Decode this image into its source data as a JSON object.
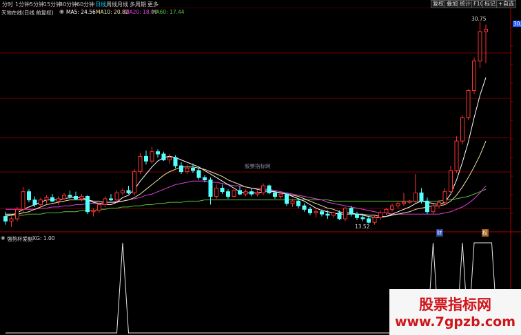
{
  "toolbar": {
    "periods": [
      "分时",
      "1分钟",
      "5分钟",
      "15分钟",
      "30分钟",
      "60分钟",
      "日线",
      "周线",
      "月线",
      "多周期",
      "更多"
    ],
    "active_period": "日线",
    "right_buttons": [
      "复权",
      "叠加",
      "统计",
      "F10",
      "标记",
      "+自选"
    ]
  },
  "main_panel": {
    "title": "天地在线(日线 前复权)",
    "ma": [
      {
        "label": "MA5: 24.56",
        "color": "#ffffff"
      },
      {
        "label": "MA10: 20.82",
        "color": "#f2e3a8"
      },
      {
        "label": "MA20: 18.09",
        "color": "#e040e0"
      },
      {
        "label": "MA60: 17.44",
        "color": "#58c038"
      }
    ],
    "high_label": "30.75",
    "low_label": "13.52",
    "price_tag": "30.",
    "watermark_center": "股票指标网",
    "event_markers": [
      "财",
      "权"
    ]
  },
  "indicator_panel": {
    "title": "强势杯爱副",
    "value_label": "XG: 1.00"
  },
  "watermark": {
    "title": "股票指标网",
    "url": "www.7gpzb.com"
  },
  "colors": {
    "up": "#ff3232",
    "down": "#54ffff",
    "grid": "#7a0000",
    "active": "#00d0ff"
  },
  "chart_data": {
    "type": "candlestick",
    "candles": [
      [
        14.2,
        14.6,
        13.5,
        13.8
      ],
      [
        13.8,
        14.2,
        13.3,
        14.0
      ],
      [
        14.0,
        15.0,
        13.8,
        14.8
      ],
      [
        14.8,
        16.7,
        14.5,
        16.3
      ],
      [
        16.3,
        16.5,
        15.4,
        15.6
      ],
      [
        15.6,
        15.9,
        15.0,
        15.2
      ],
      [
        15.2,
        15.8,
        15.0,
        15.6
      ],
      [
        15.6,
        16.0,
        15.3,
        15.8
      ],
      [
        15.8,
        16.1,
        15.4,
        15.5
      ],
      [
        15.5,
        15.9,
        15.2,
        15.7
      ],
      [
        15.7,
        16.2,
        15.6,
        16.0
      ],
      [
        16.0,
        16.4,
        15.7,
        15.9
      ],
      [
        15.9,
        16.3,
        15.6,
        15.7
      ],
      [
        15.7,
        16.1,
        15.5,
        15.9
      ],
      [
        15.9,
        16.0,
        14.4,
        14.6
      ],
      [
        14.6,
        14.9,
        14.2,
        14.7
      ],
      [
        14.7,
        15.4,
        14.5,
        15.2
      ],
      [
        15.2,
        15.9,
        15.0,
        15.7
      ],
      [
        15.7,
        16.1,
        15.5,
        15.6
      ],
      [
        15.6,
        16.4,
        15.4,
        16.2
      ],
      [
        16.2,
        16.6,
        16.0,
        16.4
      ],
      [
        16.4,
        16.8,
        16.1,
        16.2
      ],
      [
        16.2,
        18.2,
        16.0,
        18.0
      ],
      [
        18.0,
        19.6,
        17.8,
        19.3
      ],
      [
        19.3,
        19.8,
        18.6,
        18.9
      ],
      [
        18.9,
        20.1,
        18.7,
        19.7
      ],
      [
        19.7,
        19.9,
        19.2,
        19.5
      ],
      [
        19.5,
        19.7,
        18.9,
        19.0
      ],
      [
        19.0,
        19.5,
        18.7,
        19.2
      ],
      [
        19.2,
        19.4,
        18.3,
        18.5
      ],
      [
        18.5,
        18.8,
        17.8,
        18.0
      ],
      [
        18.0,
        18.6,
        17.8,
        18.3
      ],
      [
        18.3,
        18.7,
        17.9,
        18.1
      ],
      [
        18.1,
        18.4,
        17.3,
        17.5
      ],
      [
        17.5,
        17.7,
        17.1,
        17.3
      ],
      [
        17.3,
        17.5,
        15.2,
        15.9
      ],
      [
        15.9,
        16.9,
        15.7,
        16.6
      ],
      [
        16.6,
        16.9,
        16.1,
        16.3
      ],
      [
        16.3,
        16.5,
        15.7,
        15.9
      ],
      [
        15.9,
        16.6,
        15.8,
        16.4
      ],
      [
        16.4,
        16.8,
        16.0,
        16.1
      ],
      [
        16.1,
        16.5,
        15.9,
        16.3
      ],
      [
        16.3,
        16.6,
        15.9,
        16.1
      ],
      [
        16.1,
        16.4,
        15.9,
        16.2
      ],
      [
        16.2,
        17.0,
        16.0,
        16.8
      ],
      [
        16.8,
        16.9,
        16.1,
        16.2
      ],
      [
        16.2,
        16.4,
        15.7,
        15.9
      ],
      [
        15.9,
        16.2,
        15.7,
        16.1
      ],
      [
        16.1,
        16.2,
        15.1,
        15.3
      ],
      [
        15.3,
        15.7,
        15.0,
        15.5
      ],
      [
        15.5,
        15.7,
        14.9,
        15.1
      ],
      [
        15.1,
        15.3,
        14.6,
        14.8
      ],
      [
        14.8,
        15.0,
        14.3,
        14.5
      ],
      [
        14.5,
        14.9,
        14.1,
        14.6
      ],
      [
        14.6,
        14.8,
        14.2,
        14.4
      ],
      [
        14.4,
        14.7,
        14.0,
        14.3
      ],
      [
        14.3,
        14.6,
        14.1,
        14.5
      ],
      [
        14.5,
        14.7,
        13.9,
        14.0
      ],
      [
        14.0,
        15.0,
        13.8,
        14.9
      ],
      [
        14.9,
        15.1,
        14.2,
        14.4
      ],
      [
        14.4,
        14.6,
        13.9,
        14.1
      ],
      [
        14.1,
        14.4,
        13.8,
        14.0
      ],
      [
        14.0,
        14.2,
        13.6,
        13.7
      ],
      [
        13.7,
        14.3,
        13.5,
        14.1
      ],
      [
        14.1,
        14.7,
        13.9,
        14.5
      ],
      [
        14.5,
        14.9,
        14.3,
        14.8
      ],
      [
        14.8,
        15.3,
        14.6,
        15.1
      ],
      [
        15.1,
        15.5,
        14.9,
        15.3
      ],
      [
        15.3,
        16.2,
        15.1,
        15.4
      ],
      [
        15.4,
        15.6,
        15.3,
        15.5
      ],
      [
        15.5,
        17.8,
        15.3,
        16.2
      ],
      [
        16.2,
        16.6,
        15.3,
        15.5
      ],
      [
        15.5,
        15.8,
        14.4,
        14.6
      ],
      [
        14.6,
        15.3,
        14.4,
        15.1
      ],
      [
        15.1,
        15.6,
        14.9,
        15.4
      ],
      [
        15.4,
        16.6,
        15.2,
        16.3
      ],
      [
        16.3,
        18.5,
        16.1,
        18.1
      ],
      [
        18.1,
        21.0,
        17.9,
        20.6
      ],
      [
        20.6,
        22.8,
        20.3,
        22.6
      ],
      [
        22.6,
        25.0,
        22.4,
        24.9
      ],
      [
        24.9,
        27.7,
        24.6,
        27.4
      ],
      [
        27.4,
        30.75,
        26.8,
        29.9
      ],
      [
        29.9,
        30.5,
        27.2,
        30.1
      ]
    ],
    "ma5": [
      14.3,
      14.3,
      14.5,
      14.8,
      15.0,
      15.2,
      15.4,
      15.6,
      15.6,
      15.6,
      15.7,
      15.8,
      15.8,
      15.8,
      15.6,
      15.4,
      15.3,
      15.2,
      15.2,
      15.4,
      15.8,
      16.0,
      16.5,
      17.2,
      17.8,
      18.4,
      18.9,
      19.2,
      19.3,
      19.2,
      19.0,
      18.8,
      18.6,
      18.4,
      18.1,
      17.8,
      17.5,
      17.2,
      16.9,
      16.6,
      16.3,
      16.2,
      16.2,
      16.2,
      16.3,
      16.4,
      16.3,
      16.2,
      16.1,
      15.9,
      15.7,
      15.5,
      15.2,
      14.9,
      14.7,
      14.6,
      14.5,
      14.4,
      14.4,
      14.4,
      14.4,
      14.3,
      14.2,
      14.1,
      14.1,
      14.2,
      14.4,
      14.6,
      14.8,
      15.0,
      15.3,
      15.5,
      15.4,
      15.3,
      15.2,
      15.4,
      16.1,
      17.3,
      18.8,
      20.5,
      22.6,
      24.5,
      26.0
    ],
    "ma10": [
      14.4,
      14.4,
      14.4,
      14.5,
      14.6,
      14.8,
      15.0,
      15.2,
      15.3,
      15.4,
      15.5,
      15.6,
      15.6,
      15.6,
      15.6,
      15.5,
      15.5,
      15.4,
      15.4,
      15.4,
      15.5,
      15.6,
      15.8,
      16.1,
      16.5,
      16.9,
      17.3,
      17.7,
      18.0,
      18.2,
      18.4,
      18.4,
      18.4,
      18.3,
      18.2,
      18.0,
      17.8,
      17.6,
      17.3,
      17.1,
      16.9,
      16.7,
      16.6,
      16.5,
      16.4,
      16.3,
      16.3,
      16.2,
      16.1,
      16.0,
      15.9,
      15.7,
      15.5,
      15.3,
      15.1,
      14.9,
      14.8,
      14.6,
      14.5,
      14.5,
      14.4,
      14.4,
      14.3,
      14.3,
      14.2,
      14.2,
      14.3,
      14.4,
      14.5,
      14.6,
      14.8,
      14.9,
      15.0,
      15.1,
      15.1,
      15.2,
      15.5,
      16.0,
      16.7,
      17.5,
      18.4,
      19.4,
      20.6
    ],
    "ma20": [
      14.8,
      14.8,
      14.8,
      14.8,
      14.8,
      14.8,
      14.9,
      14.9,
      15.0,
      15.0,
      15.1,
      15.1,
      15.2,
      15.2,
      15.3,
      15.3,
      15.3,
      15.4,
      15.4,
      15.5,
      15.5,
      15.6,
      15.7,
      15.8,
      16.0,
      16.1,
      16.3,
      16.5,
      16.7,
      16.9,
      17.0,
      17.1,
      17.2,
      17.2,
      17.2,
      17.1,
      17.1,
      17.0,
      16.9,
      16.8,
      16.8,
      16.7,
      16.6,
      16.6,
      16.5,
      16.5,
      16.4,
      16.3,
      16.2,
      16.1,
      16.0,
      15.9,
      15.8,
      15.7,
      15.6,
      15.4,
      15.3,
      15.2,
      15.1,
      15.0,
      14.9,
      14.8,
      14.7,
      14.6,
      14.5,
      14.5,
      14.4,
      14.4,
      14.4,
      14.4,
      14.4,
      14.4,
      14.4,
      14.4,
      14.4,
      14.5,
      14.6,
      14.8,
      15.0,
      15.3,
      15.7,
      16.2,
      16.8
    ],
    "ma60": [
      14.2,
      14.3,
      14.3,
      14.3,
      14.4,
      14.4,
      14.4,
      14.5,
      14.5,
      14.5,
      14.6,
      14.6,
      14.6,
      14.7,
      14.7,
      14.7,
      14.8,
      14.8,
      14.9,
      14.9,
      15.0,
      15.0,
      15.1,
      15.1,
      15.2,
      15.2,
      15.3,
      15.3,
      15.4,
      15.4,
      15.4,
      15.5,
      15.5,
      15.5,
      15.6,
      15.6,
      15.6,
      15.6,
      15.6,
      15.6,
      15.6,
      15.6,
      15.6,
      15.6,
      15.6,
      15.6,
      15.6,
      15.6,
      15.6,
      15.6,
      15.6,
      15.6,
      15.6,
      15.6,
      15.6,
      15.6,
      15.5,
      15.5,
      15.5,
      15.5,
      15.5,
      15.5,
      15.5,
      15.5,
      15.5,
      15.5,
      15.5,
      15.5,
      15.5,
      15.5,
      15.5,
      15.5,
      15.5,
      15.5,
      15.5,
      15.6,
      15.6,
      15.7,
      15.8,
      15.9,
      16.1,
      16.3,
      16.5
    ],
    "xg_signal": [
      0,
      0,
      0,
      0,
      0,
      0,
      0,
      0,
      0,
      0,
      0,
      0,
      0,
      0,
      0,
      0,
      0,
      0,
      0,
      0,
      1,
      0,
      0,
      0,
      0,
      0,
      0,
      0,
      0,
      0,
      0,
      0,
      0,
      0,
      0,
      0,
      0,
      0,
      0,
      0,
      0,
      0,
      0,
      0,
      0,
      0,
      0,
      0,
      0,
      0,
      0,
      0,
      0,
      0,
      0,
      0,
      0,
      0,
      0,
      0,
      0,
      0,
      0,
      0,
      0,
      0,
      0,
      0,
      0,
      0,
      0,
      0,
      0,
      1,
      0,
      0,
      0,
      0,
      1,
      0,
      1,
      1,
      1,
      1,
      0
    ],
    "ylim": [
      13.3,
      31.3
    ]
  }
}
